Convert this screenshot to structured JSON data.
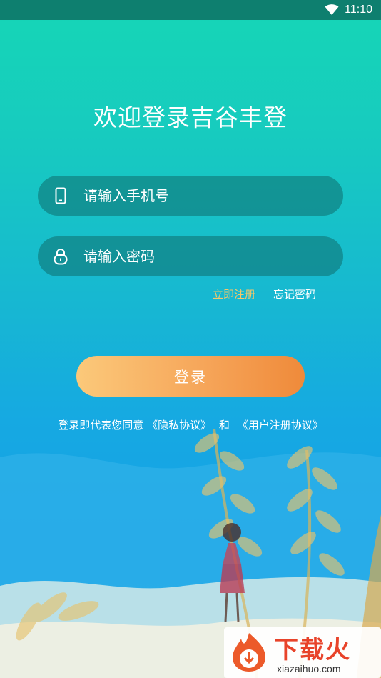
{
  "status_bar": {
    "time": "11:10"
  },
  "header": {
    "title": "欢迎登录吉谷丰登"
  },
  "form": {
    "phone_placeholder": "请输入手机号",
    "password_placeholder": "请输入密码",
    "register_link": "立即注册",
    "forgot_link": "忘记密码",
    "login_button": "登录"
  },
  "agreement": {
    "prefix": "登录即代表您同意",
    "privacy_link": "《隐私协议》",
    "conjunction": "和",
    "user_link": "《用户注册协议》"
  },
  "watermark": {
    "brand": "下载火",
    "url": "xiazaihuo.com"
  },
  "icons": [
    "wifi-icon",
    "phone-icon",
    "lock-icon",
    "download-logo-icon"
  ],
  "colors": {
    "accent_orange": "#f6a65a",
    "register_link": "#f6c86a",
    "gradient_top": "#16d6b6",
    "gradient_bottom": "#15a0e6"
  }
}
